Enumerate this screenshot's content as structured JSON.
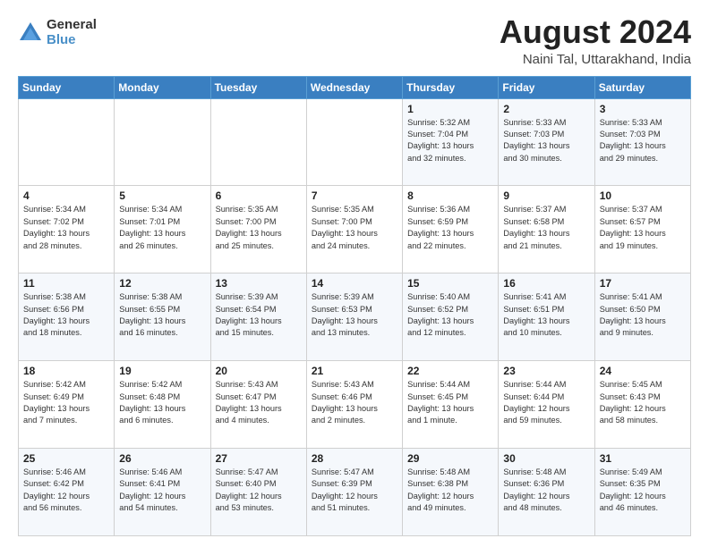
{
  "logo": {
    "general": "General",
    "blue": "Blue"
  },
  "header": {
    "month_year": "August 2024",
    "location": "Naini Tal, Uttarakhand, India"
  },
  "days_of_week": [
    "Sunday",
    "Monday",
    "Tuesday",
    "Wednesday",
    "Thursday",
    "Friday",
    "Saturday"
  ],
  "weeks": [
    [
      {
        "day": "",
        "content": ""
      },
      {
        "day": "",
        "content": ""
      },
      {
        "day": "",
        "content": ""
      },
      {
        "day": "",
        "content": ""
      },
      {
        "day": "1",
        "content": "Sunrise: 5:32 AM\nSunset: 7:04 PM\nDaylight: 13 hours\nand 32 minutes."
      },
      {
        "day": "2",
        "content": "Sunrise: 5:33 AM\nSunset: 7:03 PM\nDaylight: 13 hours\nand 30 minutes."
      },
      {
        "day": "3",
        "content": "Sunrise: 5:33 AM\nSunset: 7:03 PM\nDaylight: 13 hours\nand 29 minutes."
      }
    ],
    [
      {
        "day": "4",
        "content": "Sunrise: 5:34 AM\nSunset: 7:02 PM\nDaylight: 13 hours\nand 28 minutes."
      },
      {
        "day": "5",
        "content": "Sunrise: 5:34 AM\nSunset: 7:01 PM\nDaylight: 13 hours\nand 26 minutes."
      },
      {
        "day": "6",
        "content": "Sunrise: 5:35 AM\nSunset: 7:00 PM\nDaylight: 13 hours\nand 25 minutes."
      },
      {
        "day": "7",
        "content": "Sunrise: 5:35 AM\nSunset: 7:00 PM\nDaylight: 13 hours\nand 24 minutes."
      },
      {
        "day": "8",
        "content": "Sunrise: 5:36 AM\nSunset: 6:59 PM\nDaylight: 13 hours\nand 22 minutes."
      },
      {
        "day": "9",
        "content": "Sunrise: 5:37 AM\nSunset: 6:58 PM\nDaylight: 13 hours\nand 21 minutes."
      },
      {
        "day": "10",
        "content": "Sunrise: 5:37 AM\nSunset: 6:57 PM\nDaylight: 13 hours\nand 19 minutes."
      }
    ],
    [
      {
        "day": "11",
        "content": "Sunrise: 5:38 AM\nSunset: 6:56 PM\nDaylight: 13 hours\nand 18 minutes."
      },
      {
        "day": "12",
        "content": "Sunrise: 5:38 AM\nSunset: 6:55 PM\nDaylight: 13 hours\nand 16 minutes."
      },
      {
        "day": "13",
        "content": "Sunrise: 5:39 AM\nSunset: 6:54 PM\nDaylight: 13 hours\nand 15 minutes."
      },
      {
        "day": "14",
        "content": "Sunrise: 5:39 AM\nSunset: 6:53 PM\nDaylight: 13 hours\nand 13 minutes."
      },
      {
        "day": "15",
        "content": "Sunrise: 5:40 AM\nSunset: 6:52 PM\nDaylight: 13 hours\nand 12 minutes."
      },
      {
        "day": "16",
        "content": "Sunrise: 5:41 AM\nSunset: 6:51 PM\nDaylight: 13 hours\nand 10 minutes."
      },
      {
        "day": "17",
        "content": "Sunrise: 5:41 AM\nSunset: 6:50 PM\nDaylight: 13 hours\nand 9 minutes."
      }
    ],
    [
      {
        "day": "18",
        "content": "Sunrise: 5:42 AM\nSunset: 6:49 PM\nDaylight: 13 hours\nand 7 minutes."
      },
      {
        "day": "19",
        "content": "Sunrise: 5:42 AM\nSunset: 6:48 PM\nDaylight: 13 hours\nand 6 minutes."
      },
      {
        "day": "20",
        "content": "Sunrise: 5:43 AM\nSunset: 6:47 PM\nDaylight: 13 hours\nand 4 minutes."
      },
      {
        "day": "21",
        "content": "Sunrise: 5:43 AM\nSunset: 6:46 PM\nDaylight: 13 hours\nand 2 minutes."
      },
      {
        "day": "22",
        "content": "Sunrise: 5:44 AM\nSunset: 6:45 PM\nDaylight: 13 hours\nand 1 minute."
      },
      {
        "day": "23",
        "content": "Sunrise: 5:44 AM\nSunset: 6:44 PM\nDaylight: 12 hours\nand 59 minutes."
      },
      {
        "day": "24",
        "content": "Sunrise: 5:45 AM\nSunset: 6:43 PM\nDaylight: 12 hours\nand 58 minutes."
      }
    ],
    [
      {
        "day": "25",
        "content": "Sunrise: 5:46 AM\nSunset: 6:42 PM\nDaylight: 12 hours\nand 56 minutes."
      },
      {
        "day": "26",
        "content": "Sunrise: 5:46 AM\nSunset: 6:41 PM\nDaylight: 12 hours\nand 54 minutes."
      },
      {
        "day": "27",
        "content": "Sunrise: 5:47 AM\nSunset: 6:40 PM\nDaylight: 12 hours\nand 53 minutes."
      },
      {
        "day": "28",
        "content": "Sunrise: 5:47 AM\nSunset: 6:39 PM\nDaylight: 12 hours\nand 51 minutes."
      },
      {
        "day": "29",
        "content": "Sunrise: 5:48 AM\nSunset: 6:38 PM\nDaylight: 12 hours\nand 49 minutes."
      },
      {
        "day": "30",
        "content": "Sunrise: 5:48 AM\nSunset: 6:36 PM\nDaylight: 12 hours\nand 48 minutes."
      },
      {
        "day": "31",
        "content": "Sunrise: 5:49 AM\nSunset: 6:35 PM\nDaylight: 12 hours\nand 46 minutes."
      }
    ]
  ]
}
